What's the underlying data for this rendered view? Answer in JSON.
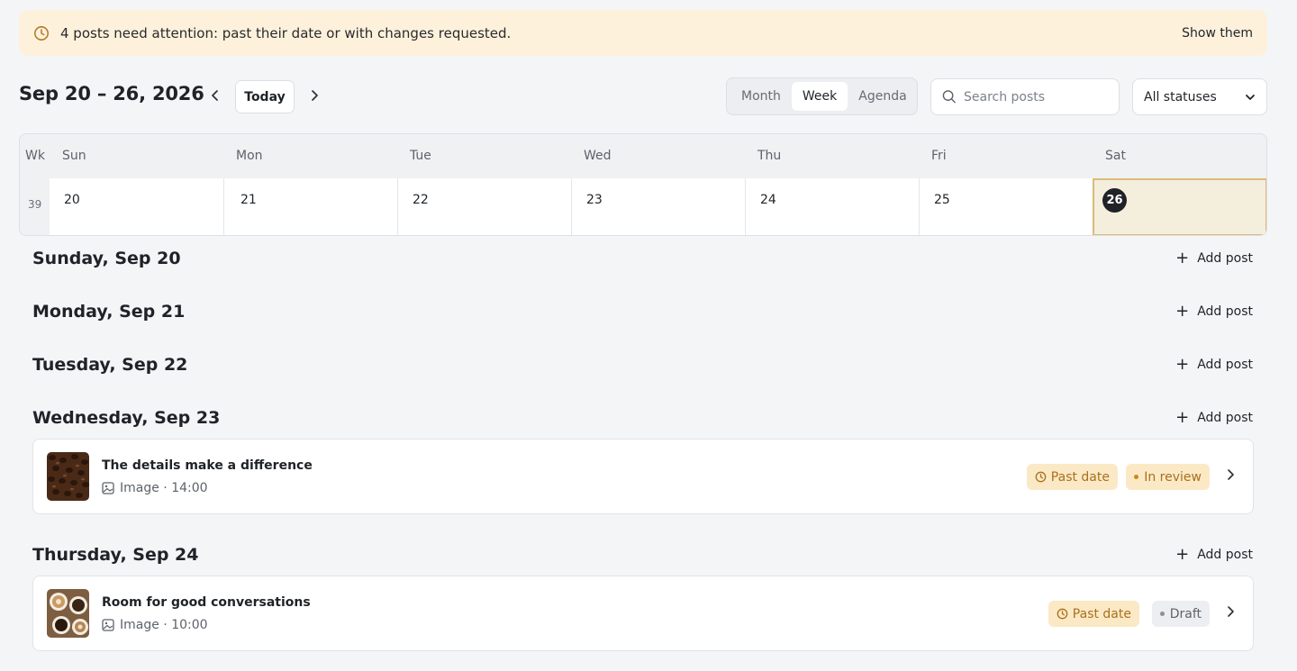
{
  "banner": {
    "message": "4 posts need attention: past their date or with changes requested.",
    "action_label": "Show them"
  },
  "toolbar": {
    "range_title": "Sep 20 – 26, 2026",
    "today_label": "Today",
    "views": [
      "Month",
      "Week",
      "Agenda"
    ],
    "active_view": "Week",
    "search_placeholder": "Search posts",
    "status_filter": "All statuses"
  },
  "week_grid": {
    "week_label": "Wk",
    "week_number": "39",
    "day_names": [
      "Sun",
      "Mon",
      "Tue",
      "Wed",
      "Thu",
      "Fri",
      "Sat"
    ],
    "dates": [
      "20",
      "21",
      "22",
      "23",
      "24",
      "25",
      "26"
    ],
    "today_date": "26"
  },
  "days": [
    {
      "title": "Sunday, Sep 20",
      "add_label": "Add post"
    },
    {
      "title": "Monday, Sep 21",
      "add_label": "Add post"
    },
    {
      "title": "Tuesday, Sep 22",
      "add_label": "Add post"
    },
    {
      "title": "Wednesday, Sep 23",
      "add_label": "Add post"
    },
    {
      "title": "Thursday, Sep 24",
      "add_label": "Add post"
    }
  ],
  "posts": [
    {
      "title": "The details make a difference",
      "meta": "Image · 14:00",
      "flag": "Past date",
      "status": "In review"
    },
    {
      "title": "Room for good conversations",
      "meta": "Image · 10:00",
      "flag": "Past date",
      "status": "Draft"
    }
  ],
  "colors": {
    "banner_bg": "#fdf1dc",
    "warning": "#a9701c",
    "today_highlight": "#f4eedd"
  }
}
